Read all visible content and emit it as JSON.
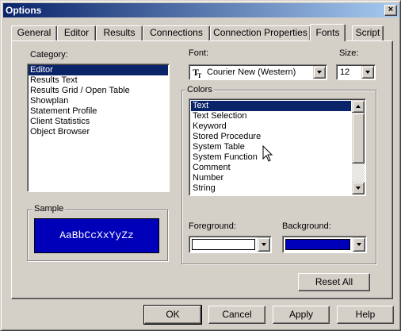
{
  "window": {
    "title": "Options",
    "close_glyph": "×"
  },
  "tabs": [
    {
      "label": "General",
      "active": false
    },
    {
      "label": "Editor",
      "active": false
    },
    {
      "label": "Results",
      "active": false
    },
    {
      "label": "Connections",
      "active": false
    },
    {
      "label": "Connection Properties",
      "active": false
    },
    {
      "label": "Fonts",
      "active": true
    },
    {
      "label": "Script",
      "active": false
    }
  ],
  "category": {
    "label": "Category:",
    "selected": "Editor",
    "items": [
      "Editor",
      "Results Text",
      "Results Grid / Open Table",
      "Showplan",
      "Statement Profile",
      "Client Statistics",
      "Object Browser"
    ]
  },
  "font": {
    "label": "Font:",
    "value": "Courier New (Western)",
    "icon": "truetype-font-icon",
    "icon_glyph": "T"
  },
  "size": {
    "label": "Size:",
    "value": "12"
  },
  "colors": {
    "label": "Colors",
    "selected": "Text",
    "items": [
      "Text",
      "Text Selection",
      "Keyword",
      "Stored Procedure",
      "System Table",
      "System Function",
      "Comment",
      "Number",
      "String"
    ]
  },
  "sample": {
    "label": "Sample",
    "text": "AaBbCcXxYyZz",
    "background": "#0000b8",
    "foreground": "#ffffff"
  },
  "foreground": {
    "label": "Foreground:",
    "color": "#ffffff"
  },
  "background": {
    "label": "Background:",
    "color": "#0000b8"
  },
  "reset_label": "Reset All",
  "buttons": {
    "ok": "OK",
    "cancel": "Cancel",
    "apply": "Apply",
    "help": "Help"
  }
}
